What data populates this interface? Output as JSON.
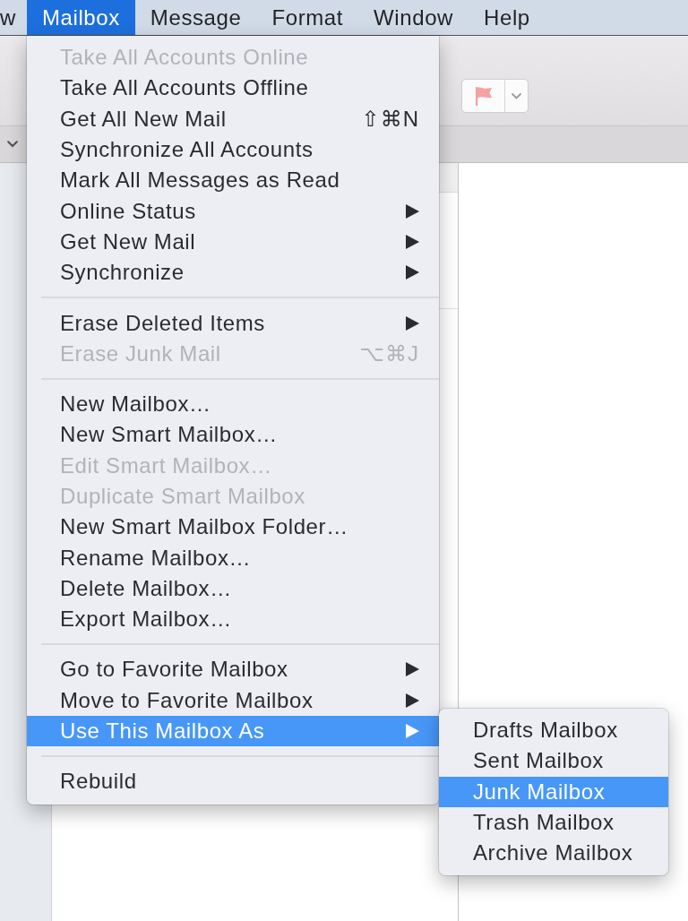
{
  "menu_bar": {
    "items": [
      {
        "label": "w",
        "selected": false
      },
      {
        "label": "Mailbox",
        "selected": true
      },
      {
        "label": "Message",
        "selected": false
      },
      {
        "label": "Format",
        "selected": false
      },
      {
        "label": "Window",
        "selected": false
      },
      {
        "label": "Help",
        "selected": false
      }
    ]
  },
  "menu": {
    "sections": [
      {
        "items": [
          {
            "label": "Take All Accounts Online",
            "disabled": true,
            "selected": false,
            "has_submenu": false
          },
          {
            "label": "Take All Accounts Offline",
            "disabled": false,
            "selected": false,
            "has_submenu": false
          },
          {
            "label": "Get All New Mail",
            "shortcut": "⇧⌘N",
            "disabled": false,
            "selected": false,
            "has_submenu": false
          },
          {
            "label": "Synchronize All Accounts",
            "disabled": false,
            "selected": false,
            "has_submenu": false
          },
          {
            "label": "Mark All Messages as Read",
            "disabled": false,
            "selected": false,
            "has_submenu": false
          },
          {
            "label": "Online Status",
            "disabled": false,
            "selected": false,
            "has_submenu": true
          },
          {
            "label": "Get New Mail",
            "disabled": false,
            "selected": false,
            "has_submenu": true
          },
          {
            "label": "Synchronize",
            "disabled": false,
            "selected": false,
            "has_submenu": true
          }
        ]
      },
      {
        "items": [
          {
            "label": "Erase Deleted Items",
            "disabled": false,
            "selected": false,
            "has_submenu": true
          },
          {
            "label": "Erase Junk Mail",
            "shortcut": "⌥⌘J",
            "disabled": true,
            "selected": false,
            "has_submenu": false
          }
        ]
      },
      {
        "items": [
          {
            "label": "New Mailbox…",
            "disabled": false,
            "selected": false,
            "has_submenu": false
          },
          {
            "label": "New Smart Mailbox…",
            "disabled": false,
            "selected": false,
            "has_submenu": false
          },
          {
            "label": "Edit Smart Mailbox…",
            "disabled": true,
            "selected": false,
            "has_submenu": false
          },
          {
            "label": "Duplicate Smart Mailbox",
            "disabled": true,
            "selected": false,
            "has_submenu": false
          },
          {
            "label": "New Smart Mailbox Folder…",
            "disabled": false,
            "selected": false,
            "has_submenu": false
          },
          {
            "label": "Rename Mailbox…",
            "disabled": false,
            "selected": false,
            "has_submenu": false
          },
          {
            "label": "Delete Mailbox…",
            "disabled": false,
            "selected": false,
            "has_submenu": false
          },
          {
            "label": "Export Mailbox…",
            "disabled": false,
            "selected": false,
            "has_submenu": false
          }
        ]
      },
      {
        "items": [
          {
            "label": "Go to Favorite Mailbox",
            "disabled": false,
            "selected": false,
            "has_submenu": true
          },
          {
            "label": "Move to Favorite Mailbox",
            "disabled": false,
            "selected": false,
            "has_submenu": true
          },
          {
            "label": "Use This Mailbox As",
            "disabled": false,
            "selected": true,
            "has_submenu": true
          }
        ]
      },
      {
        "items": [
          {
            "label": "Rebuild",
            "disabled": false,
            "selected": false,
            "has_submenu": false
          }
        ]
      }
    ]
  },
  "submenu": {
    "items": [
      {
        "label": "Drafts Mailbox",
        "selected": false
      },
      {
        "label": "Sent Mailbox",
        "selected": false
      },
      {
        "label": "Junk Mailbox",
        "selected": true
      },
      {
        "label": "Trash Mailbox",
        "selected": false
      },
      {
        "label": "Archive Mailbox",
        "selected": false
      }
    ]
  }
}
